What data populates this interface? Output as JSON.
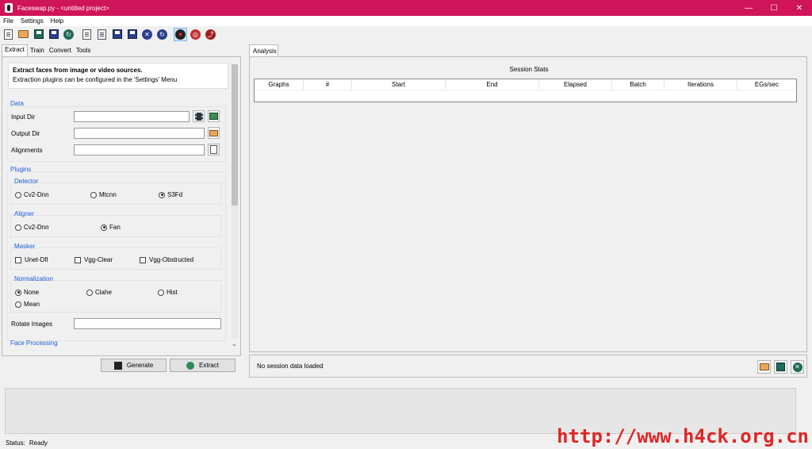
{
  "window": {
    "title": "Faceswap.py - <untitled project>"
  },
  "menu": {
    "items": [
      "File",
      "Settings",
      "Help"
    ]
  },
  "toolbar": {
    "buttons": [
      "new-project",
      "open-project",
      "save-project",
      "save-project-as",
      "reload-project",
      "new-task",
      "open-task",
      "save-task",
      "save-task-as",
      "clear-task",
      "reload-task",
      "donate",
      "help",
      "github"
    ]
  },
  "left": {
    "tabs": [
      "Extract",
      "Train",
      "Convert",
      "Tools"
    ],
    "info_title": "Extract faces from image or video sources.",
    "info_text": "Extraction plugins can be configured in the 'Settings' Menu",
    "data_label": "Data",
    "input_dir": "Input Dir",
    "output_dir": "Output Dir",
    "alignments": "Alignments",
    "plugins_label": "Plugins",
    "detector_label": "Detector",
    "detector_options": [
      "Cv2-Dnn",
      "Mtcnn",
      "S3Fd"
    ],
    "detector_selected": "S3Fd",
    "aligner_label": "Aligner",
    "aligner_options": [
      "Cv2-Dnn",
      "Fan"
    ],
    "aligner_selected": "Fan",
    "masker_label": "Masker",
    "masker_options": [
      "Unet-Dfl",
      "Vgg-Clear",
      "Vgg-Obstructed"
    ],
    "normalization_label": "Normalization",
    "normalization_options": [
      "None",
      "Clahe",
      "Hist",
      "Mean"
    ],
    "normalization_selected": "None",
    "rotate_images": "Rotate Images",
    "face_processing_label": "Face Processing",
    "generate_label": "Generate",
    "extract_label": "Extract"
  },
  "right": {
    "tab": "Analysis",
    "stats_title": "Session Stats",
    "columns": [
      "Graphs",
      "#",
      "Start",
      "End",
      "Elapsed",
      "Batch",
      "Iterations",
      "EGs/sec"
    ],
    "status_text": "No session data loaded"
  },
  "statusbar": {
    "label": "Status:",
    "value": "Ready"
  },
  "watermark": "http://www.h4ck.org.cn",
  "colors": {
    "titlebar": "#d0145a",
    "section": "#1c5fd6"
  }
}
